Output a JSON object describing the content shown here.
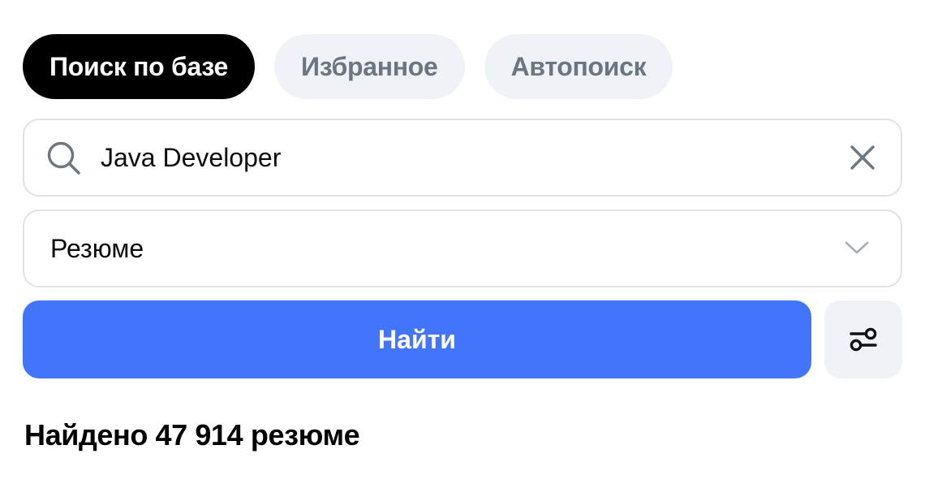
{
  "tabs": [
    {
      "label": "Поиск по базе",
      "active": true
    },
    {
      "label": "Избранное",
      "active": false
    },
    {
      "label": "Автопоиск",
      "active": false
    }
  ],
  "search": {
    "value": "Java Developer",
    "icon": "search-icon",
    "clear_icon": "close-icon"
  },
  "select": {
    "value": "Резюме",
    "icon": "chevron-down-icon"
  },
  "find_button": {
    "label": "Найти"
  },
  "filter_button": {
    "icon": "filter-settings-icon"
  },
  "results": {
    "text": "Найдено 47 914 резюме"
  },
  "colors": {
    "accent": "#4275f9",
    "tab_active_bg": "#000000",
    "tab_inactive_bg": "#eff2f6",
    "tab_inactive_text": "#6b7682",
    "border": "#dfe3e8"
  }
}
